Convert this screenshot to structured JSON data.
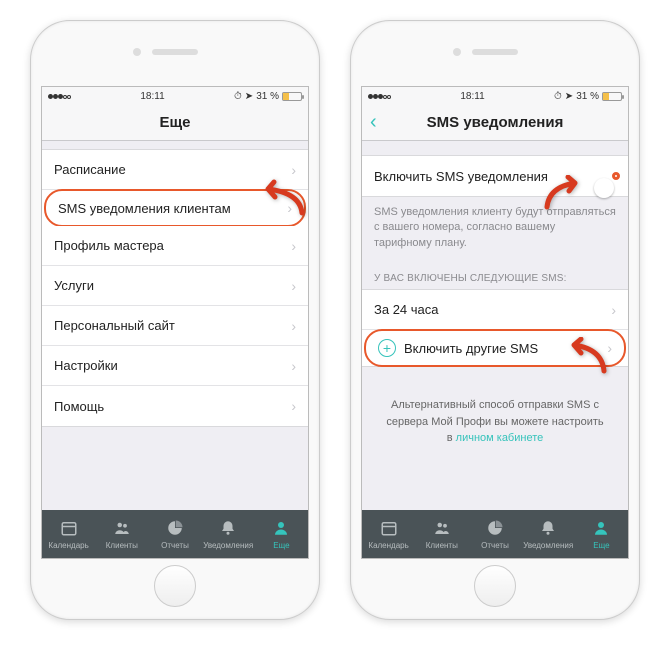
{
  "status": {
    "time": "18:11",
    "battery_pct": "31 %"
  },
  "phone1": {
    "title": "Еще",
    "menu": [
      {
        "label": "Расписание"
      },
      {
        "label": "SMS уведомления клиентам",
        "hl": true
      },
      {
        "label": "Профиль мастера"
      },
      {
        "label": "Услуги"
      },
      {
        "label": "Персональный сайт"
      },
      {
        "label": "Настройки"
      },
      {
        "label": "Помощь"
      }
    ]
  },
  "phone2": {
    "title": "SMS уведомления",
    "enable_label": "Включить SMS уведомления",
    "hint": "SMS уведомления клиенту будут отправляться с вашего номера, согласно вашему тарифному плану.",
    "section_header": "У ВАС ВКЛЮЧЕНЫ СЛЕДУЮЩИЕ SMS:",
    "row_24h": "За 24 часа",
    "row_add": "Включить другие SMS",
    "alt_text_1": "Альтернативный способ отправки SMS с сервера Мой Профи вы можете настроить в ",
    "alt_link": "личном кабинете"
  },
  "tabs": [
    {
      "label": "Календарь"
    },
    {
      "label": "Клиенты"
    },
    {
      "label": "Отчеты"
    },
    {
      "label": "Уведомления"
    },
    {
      "label": "Еще",
      "active": true
    }
  ]
}
